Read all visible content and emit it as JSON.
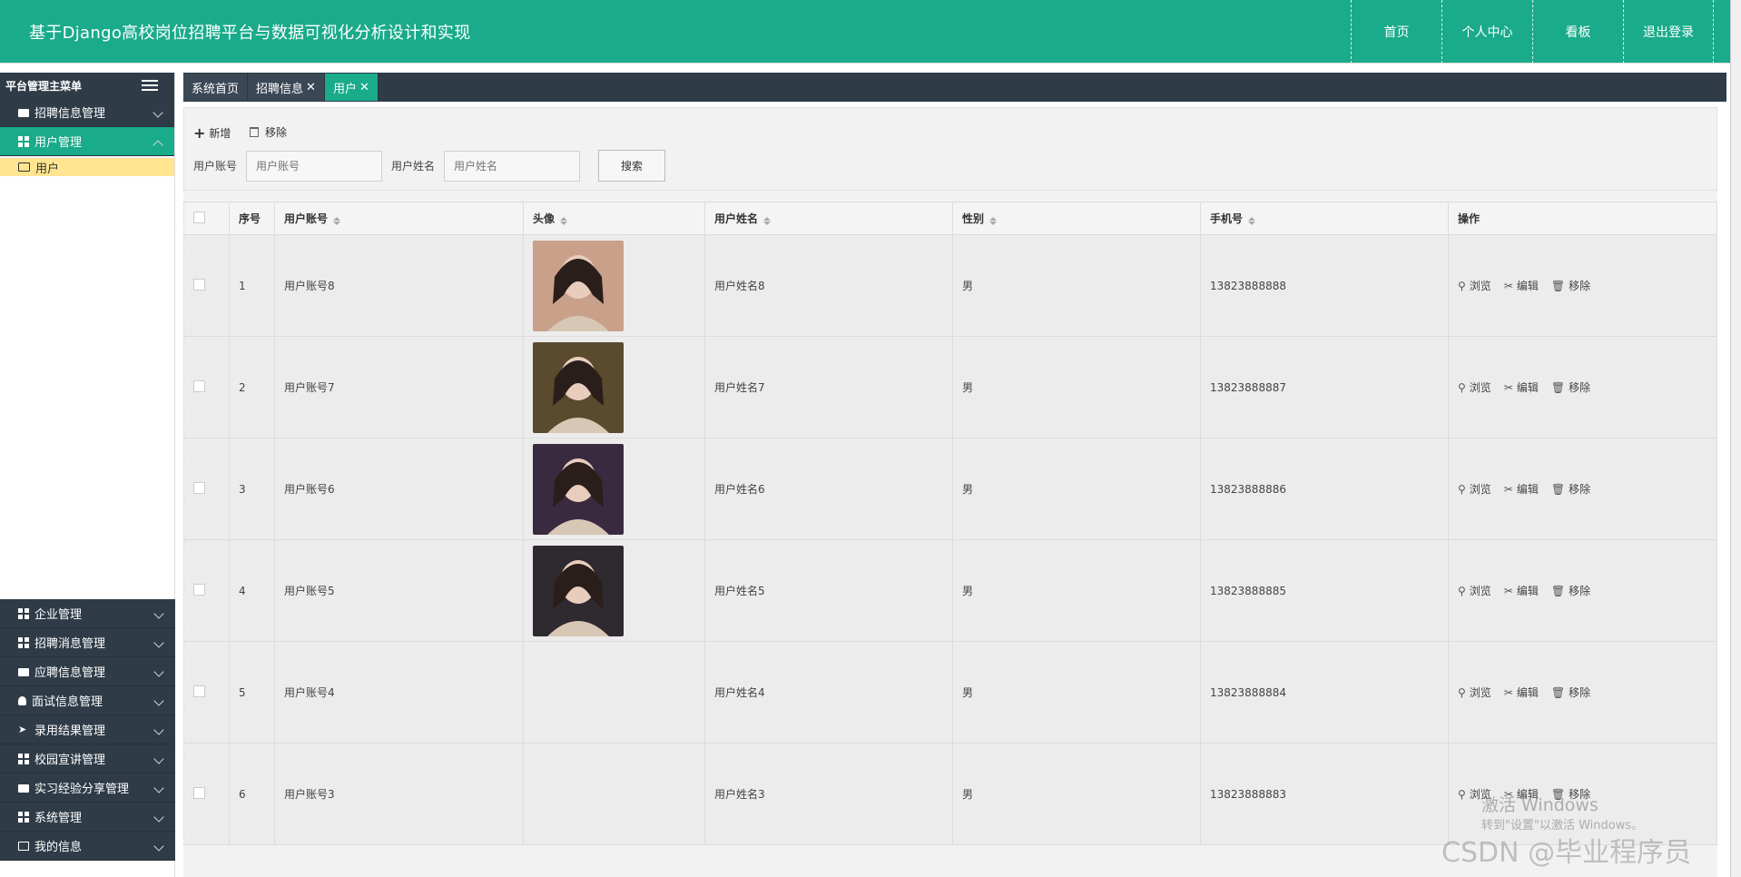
{
  "header": {
    "title": "基于Django高校岗位招聘平台与数据可视化分析设计和实现",
    "nav": [
      "首页",
      "个人中心",
      "看板",
      "退出登录"
    ]
  },
  "sidebar": {
    "title": "平台管理主菜单",
    "top_items": [
      {
        "label": "招聘信息管理",
        "icon": "briefcase-icon"
      },
      {
        "label": "用户管理",
        "icon": "grid-icon",
        "active": true
      }
    ],
    "sub_item": "用户",
    "bottom_items": [
      {
        "label": "企业管理",
        "icon": "grid-icon"
      },
      {
        "label": "招聘消息管理",
        "icon": "grid-icon"
      },
      {
        "label": "应聘信息管理",
        "icon": "hand-icon"
      },
      {
        "label": "面试信息管理",
        "icon": "user-icon"
      },
      {
        "label": "录用结果管理",
        "icon": "send-icon"
      },
      {
        "label": "校园宣讲管理",
        "icon": "grid-icon"
      },
      {
        "label": "实习经验分享管理",
        "icon": "comment-icon"
      },
      {
        "label": "系统管理",
        "icon": "grid-icon"
      },
      {
        "label": "我的信息",
        "icon": "card-icon"
      }
    ]
  },
  "tabs": [
    {
      "label": "系统首页",
      "closable": false
    },
    {
      "label": "招聘信息",
      "closable": true
    },
    {
      "label": "用户",
      "closable": true,
      "active": true
    }
  ],
  "toolbar": {
    "add_label": "新增",
    "remove_label": "移除",
    "account_label": "用户账号",
    "account_placeholder": "用户账号",
    "name_label": "用户姓名",
    "name_placeholder": "用户姓名",
    "search_label": "搜索"
  },
  "table": {
    "headers": [
      "序号",
      "用户账号",
      "头像",
      "用户姓名",
      "性别",
      "手机号",
      "操作"
    ],
    "rows": [
      {
        "no": "1",
        "account": "用户账号8",
        "has_avatar": true,
        "avatar_color": "#c9a08a",
        "name": "用户姓名8",
        "gender": "男",
        "phone": "13823888888"
      },
      {
        "no": "2",
        "account": "用户账号7",
        "has_avatar": true,
        "avatar_color": "#5a4a2e",
        "name": "用户姓名7",
        "gender": "男",
        "phone": "13823888887"
      },
      {
        "no": "3",
        "account": "用户账号6",
        "has_avatar": true,
        "avatar_color": "#3a2a40",
        "name": "用户姓名6",
        "gender": "男",
        "phone": "13823888886"
      },
      {
        "no": "4",
        "account": "用户账号5",
        "has_avatar": true,
        "avatar_color": "#2e2a30",
        "name": "用户姓名5",
        "gender": "男",
        "phone": "13823888885"
      },
      {
        "no": "5",
        "account": "用户账号4",
        "has_avatar": false,
        "name": "用户姓名4",
        "gender": "男",
        "phone": "13823888884"
      },
      {
        "no": "6",
        "account": "用户账号3",
        "has_avatar": false,
        "name": "用户姓名3",
        "gender": "男",
        "phone": "13823888883"
      }
    ],
    "actions": [
      "浏览",
      "编辑",
      "移除"
    ]
  },
  "watermarks": {
    "activate_title": "激活 Windows",
    "activate_sub": "转到\"设置\"以激活 Windows。",
    "csdn": "CSDN @毕业程序员"
  },
  "colors": {
    "primary": "#1aab8a",
    "dark": "#2f3c48",
    "highlight": "#ffe58f"
  }
}
